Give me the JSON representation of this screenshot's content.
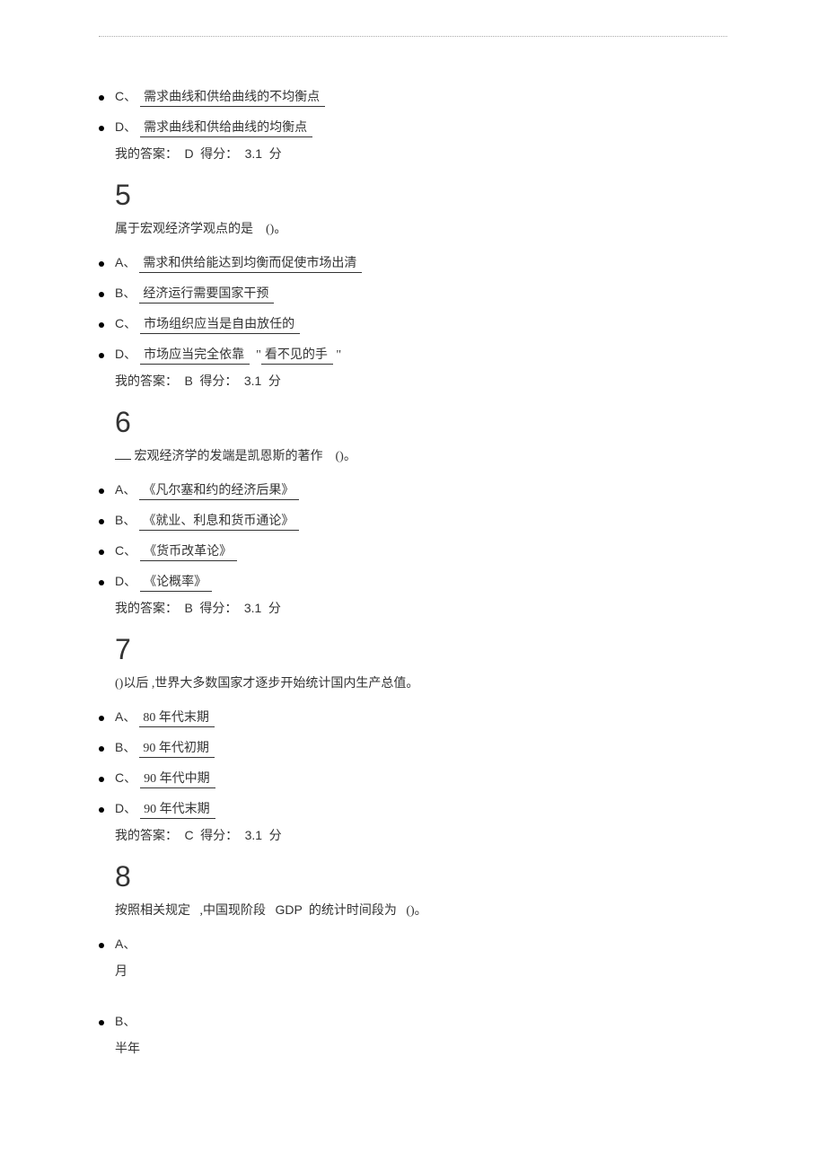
{
  "q4": {
    "optC": {
      "letter": "C、",
      "text": "需求曲线和供给曲线的不均衡点"
    },
    "optD": {
      "letter": "D、",
      "text": "需求曲线和供给曲线的均衡点"
    },
    "answer_label": "我的答案：",
    "answer_value": "D",
    "score_label": "得分：",
    "score_value": "3.1",
    "score_unit": "分"
  },
  "q5": {
    "num": "5",
    "text_main": "属于宏观经济学观点的是",
    "text_tail": "()。",
    "optA": {
      "letter": "A、",
      "text": "需求和供给能达到均衡而促使市场出清"
    },
    "optB": {
      "letter": "B、",
      "text": "经济运行需要国家干预"
    },
    "optC": {
      "letter": "C、",
      "text": "市场组织应当是自由放任的"
    },
    "optD": {
      "letter": "D、",
      "text_a": "市场应当完全依靠",
      "text_gap": "\"",
      "text_b": "看不见的手",
      "text_c": "\""
    },
    "answer_label": "我的答案：",
    "answer_value": "B",
    "score_label": "得分：",
    "score_value": "3.1",
    "score_unit": "分"
  },
  "q6": {
    "num": "6",
    "text_main": "宏观经济学的发端是凯恩斯的著作",
    "text_tail": "()。",
    "optA": {
      "letter": "A、",
      "text": "《凡尔塞和约的经济后果》"
    },
    "optB": {
      "letter": "B、",
      "text": "《就业、利息和货币通论》"
    },
    "optC": {
      "letter": "C、",
      "text": "《货币改革论》"
    },
    "optD": {
      "letter": "D、",
      "text": "《论概率》"
    },
    "answer_label": "我的答案：",
    "answer_value": "B",
    "score_label": "得分：",
    "score_value": "3.1",
    "score_unit": "分"
  },
  "q7": {
    "num": "7",
    "text_pre": "()以后 ,世界大多数国家才逐步开始统计国内生产总值。",
    "optA": {
      "letter": "A、",
      "text": "80 年代末期"
    },
    "optB": {
      "letter": "B、",
      "text": "90 年代初期"
    },
    "optC": {
      "letter": "C、",
      "text": "90 年代中期"
    },
    "optD": {
      "letter": "D、",
      "text": "90 年代末期"
    },
    "answer_label": "我的答案：",
    "answer_value": "C",
    "score_label": "得分：",
    "score_value": "3.1",
    "score_unit": "分"
  },
  "q8": {
    "num": "8",
    "text_a": "按照相关规定",
    "text_b": ",中国现阶段",
    "text_c": "GDP",
    "text_d": "的统计时间段为",
    "text_e": "()。",
    "optA": {
      "letter": "A、",
      "text": "月"
    },
    "optB": {
      "letter": "B、",
      "text": "半年"
    }
  }
}
